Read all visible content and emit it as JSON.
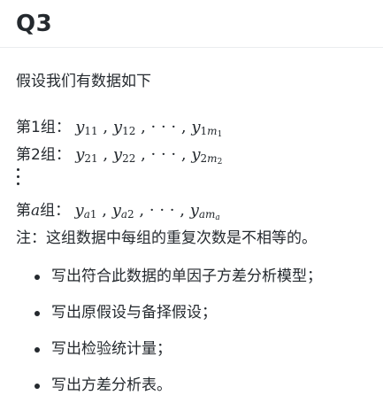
{
  "heading": "Q3",
  "intro": "假设我们有数据如下",
  "groups": [
    {
      "label": "第1组：",
      "math": {
        "base": "y",
        "sub_a": "1",
        "sub_b": "1",
        "sub_c": "2",
        "sub_last_a": "1",
        "sub_last_m": "m",
        "sub_last_sub": "1"
      }
    },
    {
      "label": "第2组：",
      "math": {
        "base": "y",
        "sub_a": "2",
        "sub_b": "1",
        "sub_c": "2",
        "sub_last_a": "2",
        "sub_last_m": "m",
        "sub_last_sub": "2"
      }
    },
    {
      "label_pre": "第",
      "label_var": "a",
      "label_post": "组：",
      "math": {
        "base": "y",
        "sub_a": "a",
        "sub_b": "1",
        "sub_c": "2",
        "sub_last_a": "a",
        "sub_last_m": "m",
        "sub_last_sub": "a"
      }
    }
  ],
  "separator": ",",
  "ellipsis": "· · ·",
  "note": "注：这组数据中每组的重复次数是不相等的。",
  "tasks": [
    "写出符合此数据的单因子方差分析模型；",
    "写出原假设与备择假设；",
    "写出检验统计量；",
    "写出方差分析表。"
  ]
}
